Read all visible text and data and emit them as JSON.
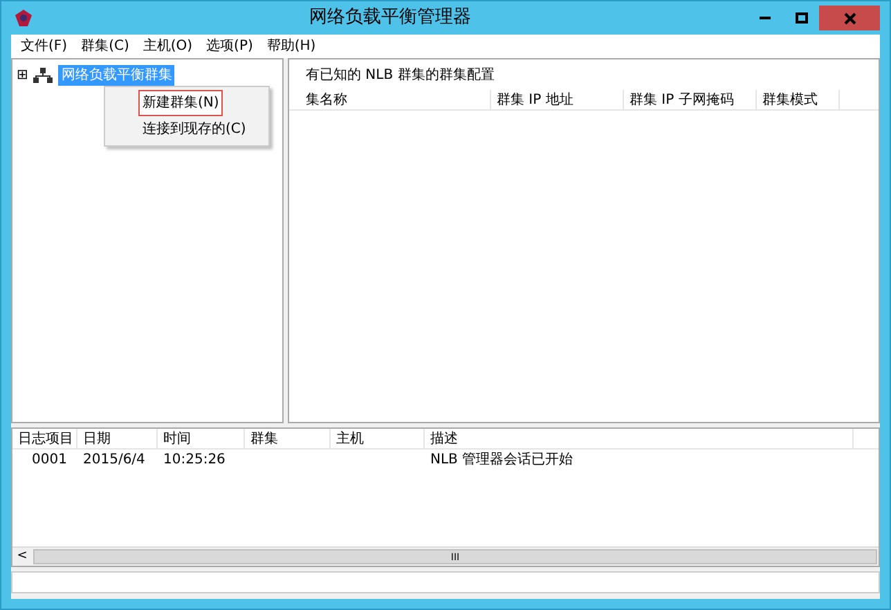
{
  "window": {
    "title": "网络负载平衡管理器"
  },
  "menu": [
    "文件(F)",
    "群集(C)",
    "主机(O)",
    "选项(P)",
    "帮助(H)"
  ],
  "tree": {
    "expander": "⊞",
    "label": "网络负载平衡群集",
    "selected": true
  },
  "context_menu": [
    {
      "label": "新建群集(N)",
      "selected": true
    },
    {
      "label": "连接到现存的(C)",
      "selected": false
    }
  ],
  "right_pane": {
    "heading": "有已知的 NLB 群集的群集配置",
    "columns": [
      "集名称",
      "群集 IP 地址",
      "群集 IP 子网掩码",
      "群集模式"
    ]
  },
  "log": {
    "columns": [
      "日志项目",
      "日期",
      "时间",
      "群集",
      "主机",
      "描述"
    ],
    "rows": [
      [
        "0001",
        "2015/6/4",
        "10:25:26",
        "",
        "",
        "NLB 管理器会话已开始"
      ]
    ]
  },
  "scrollbar": {
    "left": "<",
    "grip": "III"
  }
}
